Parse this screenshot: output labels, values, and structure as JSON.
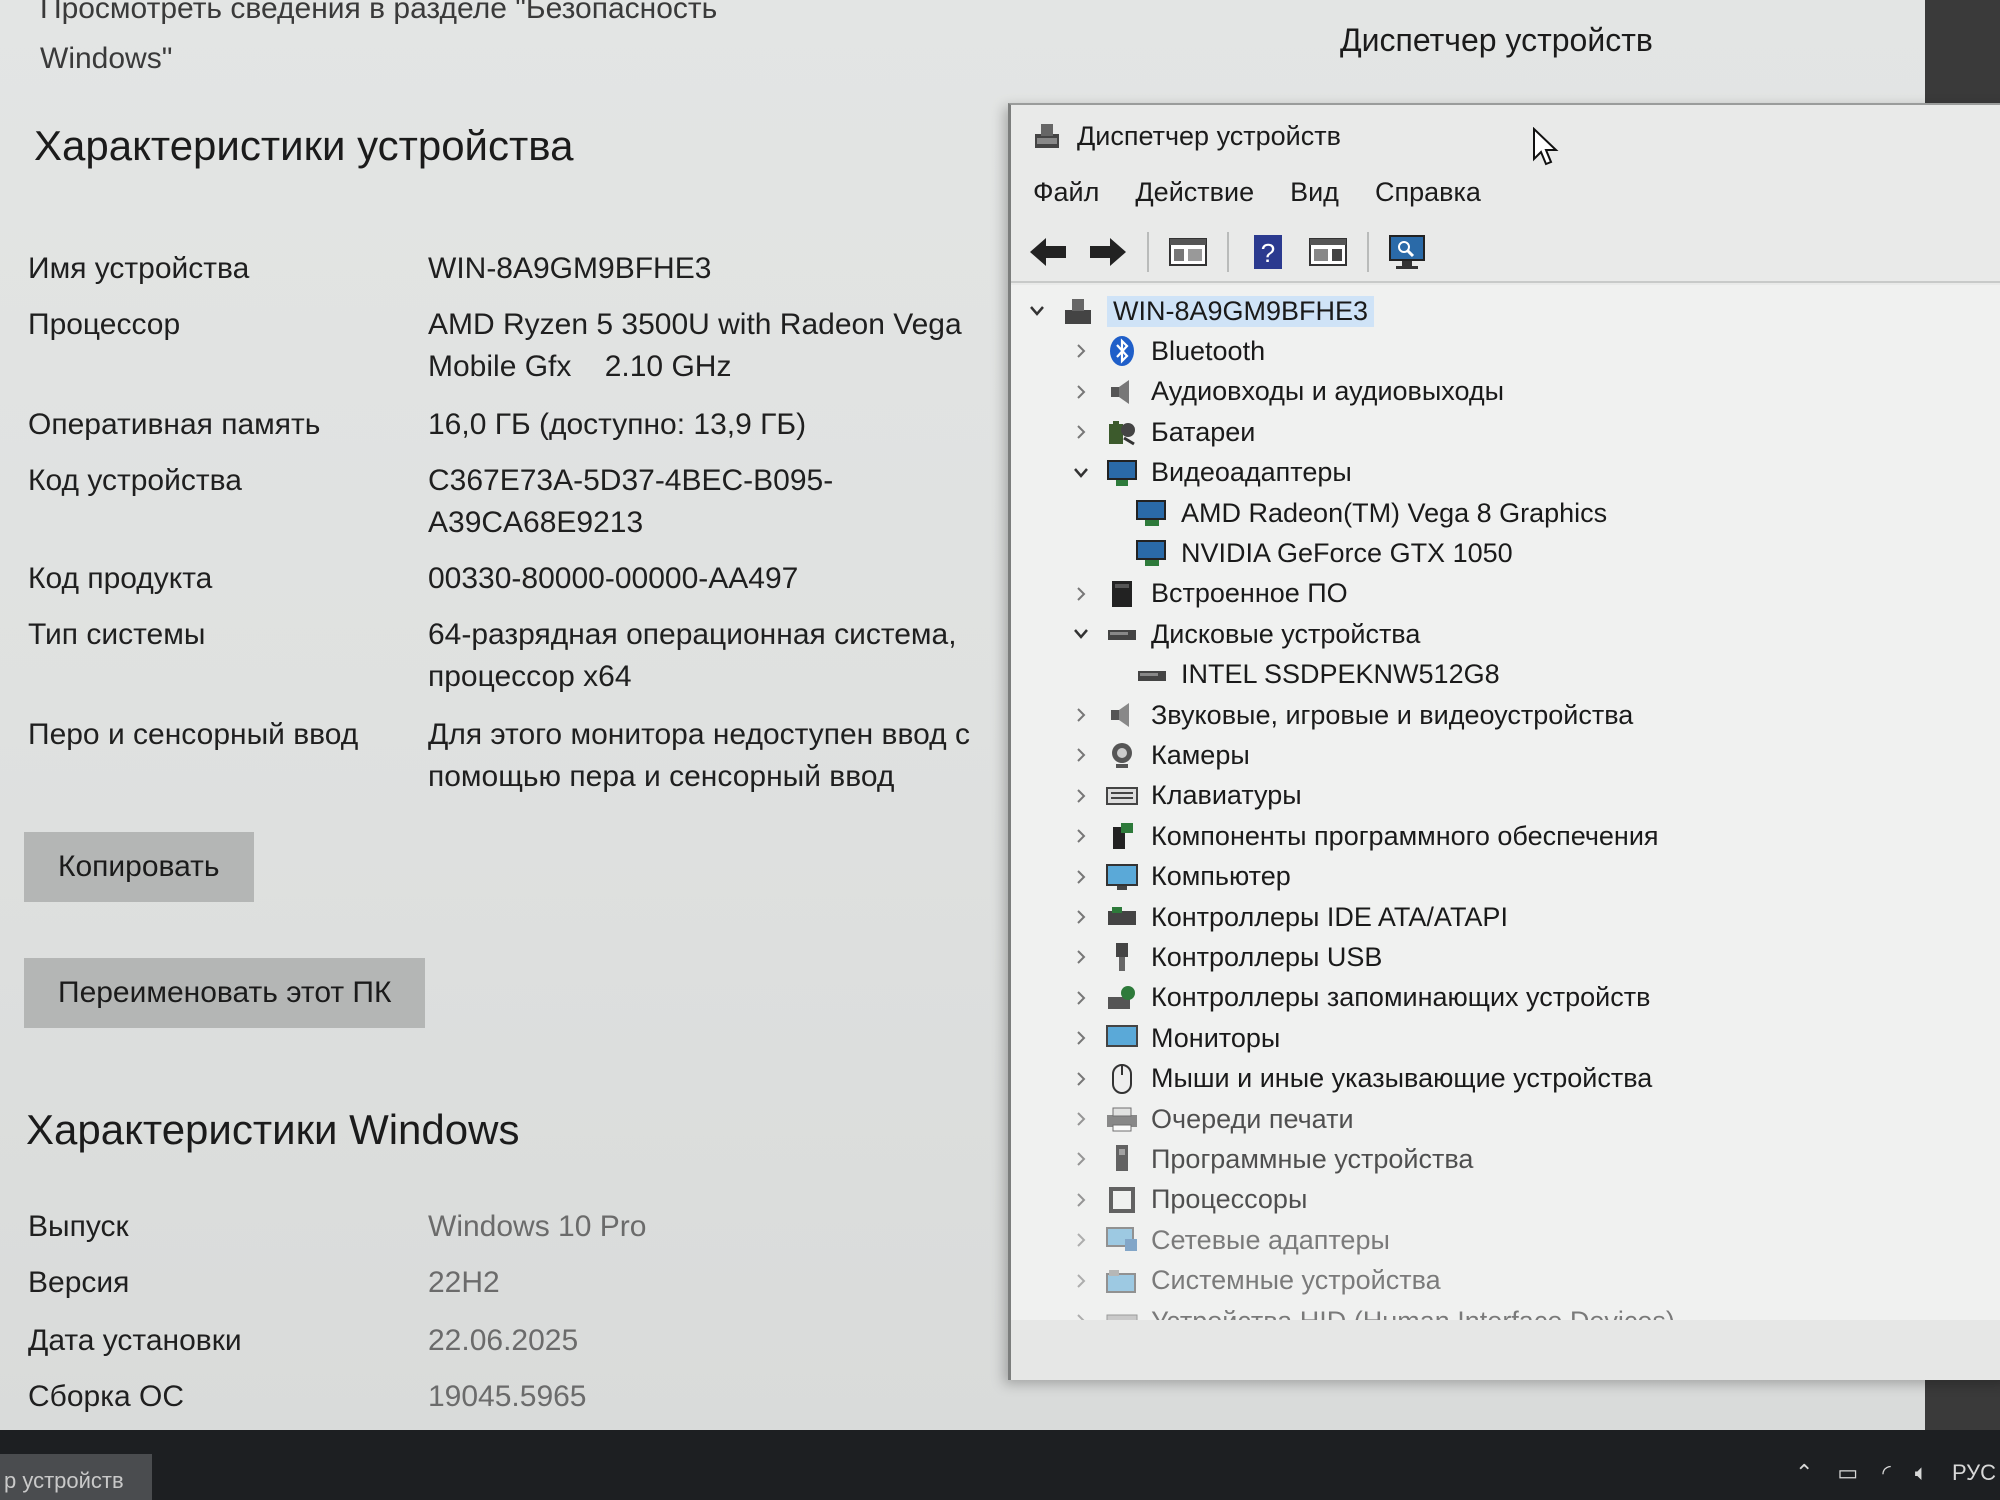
{
  "settings": {
    "top_link": "Просмотреть сведения в разделе \"Безопасность Windows\"",
    "window_caption": "Диспетчер устройств",
    "device_specs_title": "Характеристики устройства",
    "specs": [
      {
        "label": "Имя устройства",
        "value": "WIN-8A9GM9BFHE3"
      },
      {
        "label": "Процессор",
        "value": "AMD Ryzen 5 3500U with Radeon Vega Mobile Gfx    2.10 GHz"
      },
      {
        "label": "Оперативная память",
        "value": "16,0 ГБ (доступно: 13,9 ГБ)"
      },
      {
        "label": "Код устройства",
        "value": "C367E73A-5D37-4BEC-B095-A39CA68E9213"
      },
      {
        "label": "Код продукта",
        "value": "00330-80000-00000-AA497"
      },
      {
        "label": "Тип системы",
        "value": "64-разрядная операционная система, процессор x64"
      },
      {
        "label": "Перо и сенсорный ввод",
        "value": "Для этого монитора недоступен ввод с помощью пера и сенсорный ввод"
      }
    ],
    "copy_button": "Копировать",
    "rename_button": "Переименовать этот ПК",
    "windows_specs_title": "Характеристики Windows",
    "windows_specs": [
      {
        "label": "Выпуск",
        "value": "Windows 10 Pro"
      },
      {
        "label": "Версия",
        "value": "22H2"
      },
      {
        "label": "Дата установки",
        "value": "22.06.2025"
      },
      {
        "label": "Сборка ОС",
        "value": "19045.5965"
      }
    ]
  },
  "device_manager": {
    "title": "Диспетчер устройств",
    "menu": [
      "Файл",
      "Действие",
      "Вид",
      "Справка"
    ],
    "root": "WIN-8A9GM9BFHE3",
    "tree": [
      {
        "label": "Bluetooth",
        "expanded": false,
        "icon": "bluetooth-icon"
      },
      {
        "label": "Аудиовходы и аудиовыходы",
        "expanded": false,
        "icon": "speaker-icon"
      },
      {
        "label": "Батареи",
        "expanded": false,
        "icon": "battery-icon"
      },
      {
        "label": "Видеоадаптеры",
        "expanded": true,
        "icon": "display-adapter-icon",
        "children": [
          "AMD Radeon(TM) Vega 8 Graphics",
          "NVIDIA GeForce GTX 1050"
        ]
      },
      {
        "label": "Встроенное ПО",
        "expanded": false,
        "icon": "firmware-icon"
      },
      {
        "label": "Дисковые устройства",
        "expanded": true,
        "icon": "disk-icon",
        "children": [
          "INTEL SSDPEKNW512G8"
        ]
      },
      {
        "label": "Звуковые, игровые и видеоустройства",
        "expanded": false,
        "icon": "sound-icon"
      },
      {
        "label": "Камеры",
        "expanded": false,
        "icon": "camera-icon"
      },
      {
        "label": "Клавиатуры",
        "expanded": false,
        "icon": "keyboard-icon"
      },
      {
        "label": "Компоненты программного обеспечения",
        "expanded": false,
        "icon": "software-component-icon"
      },
      {
        "label": "Компьютер",
        "expanded": false,
        "icon": "computer-icon"
      },
      {
        "label": "Контроллеры IDE ATA/ATAPI",
        "expanded": false,
        "icon": "ide-controller-icon"
      },
      {
        "label": "Контроллеры USB",
        "expanded": false,
        "icon": "usb-icon"
      },
      {
        "label": "Контроллеры запоминающих устройств",
        "expanded": false,
        "icon": "storage-controller-icon"
      },
      {
        "label": "Мониторы",
        "expanded": false,
        "icon": "monitor-icon"
      },
      {
        "label": "Мыши и иные указывающие устройства",
        "expanded": false,
        "icon": "mouse-icon"
      },
      {
        "label": "Очереди печати",
        "expanded": false,
        "icon": "printer-icon"
      },
      {
        "label": "Программные устройства",
        "expanded": false,
        "icon": "software-device-icon"
      },
      {
        "label": "Процессоры",
        "expanded": false,
        "icon": "processor-icon"
      },
      {
        "label": "Сетевые адаптеры",
        "expanded": false,
        "icon": "network-adapter-icon"
      },
      {
        "label": "Системные устройства",
        "expanded": false,
        "icon": "system-device-icon"
      },
      {
        "label": "Устройства HID (Human Interface Devices)",
        "expanded": false,
        "icon": "hid-icon"
      }
    ]
  },
  "taskbar": {
    "task_label": "р устройств",
    "language": "РУС"
  },
  "colors": {
    "selection": "#cfe3f7",
    "button": "#b4b6b5",
    "bluetooth": "#1f5fc9"
  }
}
